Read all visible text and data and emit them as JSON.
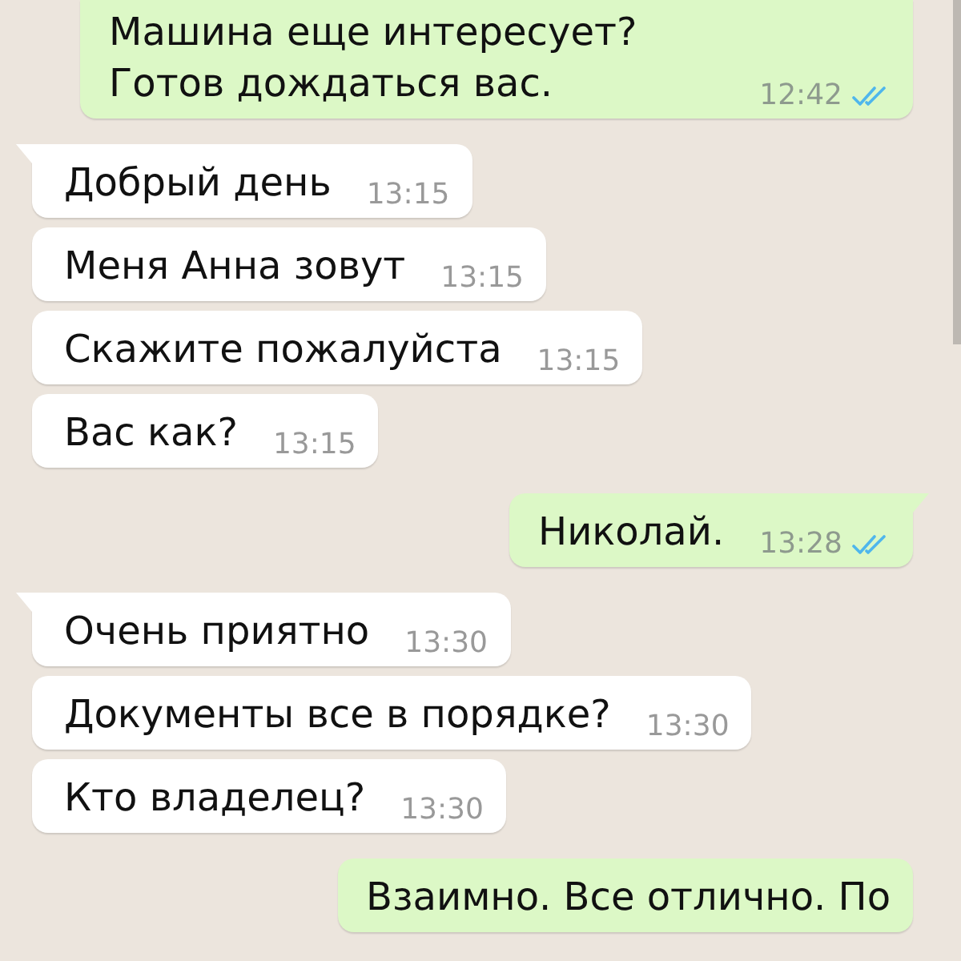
{
  "messages": [
    {
      "kind": "outgoing",
      "tail": false,
      "text": "Машина еще интересует? Готов дождаться вас.",
      "time": "12:42",
      "read": true
    },
    {
      "kind": "incoming",
      "tail": true,
      "text": "Добрый день",
      "time": "13:15"
    },
    {
      "kind": "incoming",
      "tail": false,
      "text": "Меня Анна зовут",
      "time": "13:15"
    },
    {
      "kind": "incoming",
      "tail": false,
      "text": "Скажите пожалуйста",
      "time": "13:15"
    },
    {
      "kind": "incoming",
      "tail": false,
      "text": "Вас как?",
      "time": "13:15"
    },
    {
      "kind": "outgoing",
      "tail": true,
      "text": "Николай.",
      "time": "13:28",
      "read": true
    },
    {
      "kind": "incoming",
      "tail": true,
      "text": "Очень приятно",
      "time": "13:30"
    },
    {
      "kind": "incoming",
      "tail": false,
      "text": "Документы все в порядке?",
      "time": "13:30"
    },
    {
      "kind": "incoming",
      "tail": false,
      "text": "Кто владелец?",
      "time": "13:30"
    },
    {
      "kind": "outgoing",
      "tail": false,
      "text": "Взаимно. Все отлично. По"
    }
  ]
}
